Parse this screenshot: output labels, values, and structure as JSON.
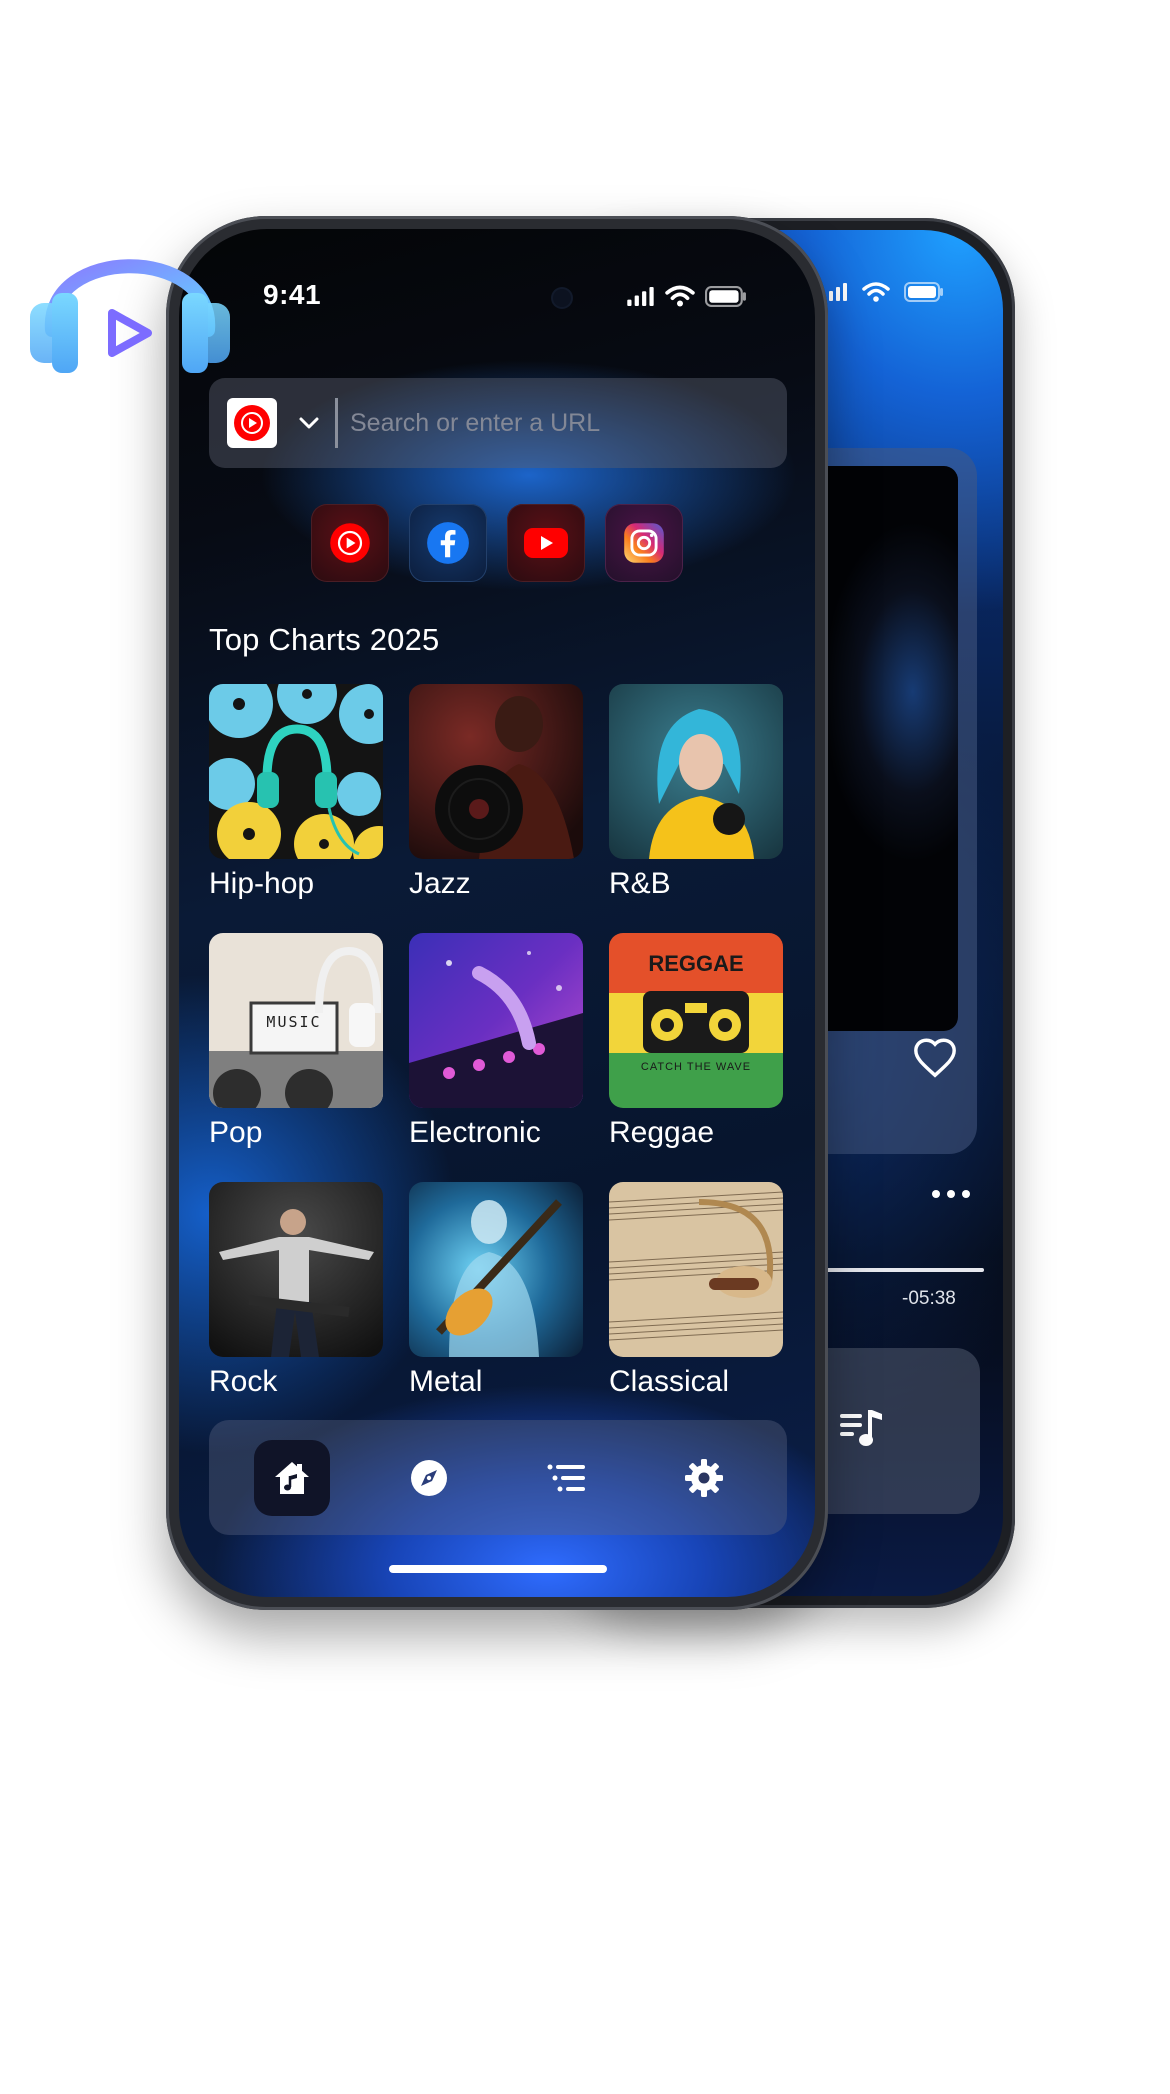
{
  "status": {
    "time": "9:41"
  },
  "search": {
    "site_icon": "youtube-music-icon",
    "placeholder": "Search or enter a URL",
    "value": ""
  },
  "quick_links": [
    {
      "name": "quick-link-youtube-music",
      "icon": "youtube-music-icon",
      "color": "#ff0000"
    },
    {
      "name": "quick-link-facebook",
      "icon": "facebook-icon",
      "color": "#1877f2"
    },
    {
      "name": "quick-link-youtube",
      "icon": "youtube-icon",
      "color": "#ff0000"
    },
    {
      "name": "quick-link-instagram",
      "icon": "instagram-icon",
      "color": "#e1306c"
    }
  ],
  "section_title": "Top Charts 2025",
  "genres": [
    {
      "label": "Hip-hop"
    },
    {
      "label": "Jazz"
    },
    {
      "label": "R&B"
    },
    {
      "label": "Pop"
    },
    {
      "label": "Electronic"
    },
    {
      "label": "Reggae"
    },
    {
      "label": "Rock"
    },
    {
      "label": "Metal"
    },
    {
      "label": "Classical"
    }
  ],
  "artwork_text": {
    "pop_sign": "MUSIC",
    "reggae_title": "REGGAE",
    "reggae_tagline": "CATCH THE WAVE"
  },
  "bottom_nav": [
    {
      "name": "home",
      "icon": "home-music-icon",
      "active": true
    },
    {
      "name": "explore",
      "icon": "compass-icon",
      "active": false
    },
    {
      "name": "playlists",
      "icon": "list-icon",
      "active": false
    },
    {
      "name": "settings",
      "icon": "gear-icon",
      "active": false
    }
  ],
  "player": {
    "time_remaining": "-05:38"
  },
  "colors": {
    "accent": "#2f6cff",
    "logo_gradient_start": "#8a7cff",
    "logo_gradient_end": "#5fd7ff"
  }
}
